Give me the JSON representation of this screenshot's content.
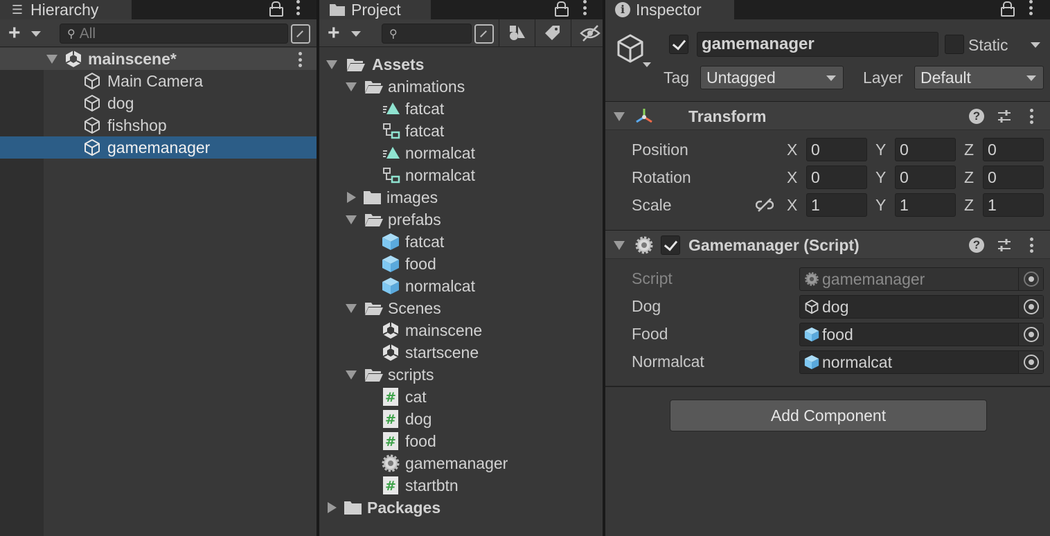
{
  "hierarchy": {
    "tab_label": "Hierarchy",
    "search_placeholder": "All",
    "scene_name": "mainscene*",
    "items": [
      {
        "label": "Main Camera"
      },
      {
        "label": "dog"
      },
      {
        "label": "fishshop"
      },
      {
        "label": "gamemanager",
        "selected": true
      }
    ]
  },
  "project": {
    "tab_label": "Project",
    "search_placeholder": "",
    "tree": {
      "assets": "Assets",
      "animations": "animations",
      "animation_items": [
        "fatcat",
        "fatcat",
        "normalcat",
        "normalcat"
      ],
      "images": "images",
      "prefabs": "prefabs",
      "prefab_items": [
        "fatcat",
        "food",
        "normalcat"
      ],
      "scenes": "Scenes",
      "scene_items": [
        "mainscene",
        "startscene"
      ],
      "scripts": "scripts",
      "script_items": [
        "cat",
        "dog",
        "food",
        "gamemanager",
        "startbtn"
      ],
      "packages": "Packages"
    }
  },
  "inspector": {
    "tab_label": "Inspector",
    "object_active": true,
    "object_name": "gamemanager",
    "static_label": "Static",
    "static_checked": false,
    "tag_label": "Tag",
    "tag_value": "Untagged",
    "layer_label": "Layer",
    "layer_value": "Default",
    "transform": {
      "title": "Transform",
      "position_label": "Position",
      "rotation_label": "Rotation",
      "scale_label": "Scale",
      "axis_x": "X",
      "axis_y": "Y",
      "axis_z": "Z",
      "position": {
        "x": "0",
        "y": "0",
        "z": "0"
      },
      "rotation": {
        "x": "0",
        "y": "0",
        "z": "0"
      },
      "scale": {
        "x": "1",
        "y": "1",
        "z": "1"
      }
    },
    "script_component": {
      "title": "Gamemanager (Script)",
      "enabled": true,
      "fields": {
        "script_label": "Script",
        "script_value": "gamemanager",
        "dog_label": "Dog",
        "dog_value": "dog",
        "food_label": "Food",
        "food_value": "food",
        "normalcat_label": "Normalcat",
        "normalcat_value": "normalcat"
      }
    },
    "add_component_label": "Add Component"
  },
  "colors": {
    "selection": "#2c5d87",
    "panel_bg": "#383838",
    "field_bg": "#2a2a2a",
    "prefab_blue": "#7fc8f2",
    "anim_teal": "#8fe3d0",
    "script_green": "#3ea34a"
  }
}
